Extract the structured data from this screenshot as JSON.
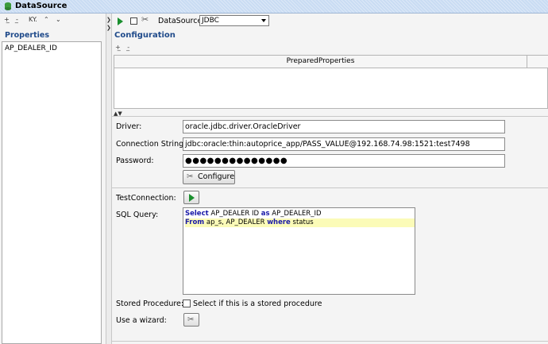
{
  "window": {
    "title": "DataSource"
  },
  "left_panel": {
    "toolbar": [
      "add-icon",
      "remove-icon",
      "sort-keys-icon",
      "move-up-icon",
      "move-down-icon"
    ],
    "toolbar_keys_label": "KY.",
    "heading": "Properties",
    "items": [
      "AP_DEALER_ID"
    ]
  },
  "main_toolbar": {
    "datasource_label": "DataSource:",
    "datasource_value": "JDBC"
  },
  "configuration": {
    "heading": "Configuration",
    "table_header": "PreparedProperties"
  },
  "form": {
    "driver_label": "Driver:",
    "driver_value": "oracle.jdbc.driver.OracleDriver",
    "connection_label": "Connection String:",
    "connection_value": "jdbc:oracle:thin:autoprice_app/PASS_VALUE@192.168.74.98:1521:test7498",
    "password_label": "Password:",
    "password_value": "●●●●●●●●●●●●●●",
    "configure_label": "Configure",
    "test_connection_label": "TestConnection:",
    "sql_label": "SQL Query:",
    "sql_line1": {
      "k1": "Select",
      "t1": " AP_DEALER ID ",
      "k2": "as",
      "t2": " AP_DEALER_ID"
    },
    "sql_line2": {
      "k1": "From",
      "t1": " ap_s, AP_DEALER ",
      "k2": "where",
      "t2": " status"
    },
    "stored_proc_label": "Stored Procedure:",
    "stored_proc_checkbox_text": "Select if this is a stored procedure",
    "wizard_label": "Use a wizard:"
  },
  "colors": {
    "accent_heading": "#1f4a8a",
    "sql_keyword": "#1a1aa8",
    "run_green": "#1a8f2e",
    "sql_highlight": "#fbfbb8"
  }
}
